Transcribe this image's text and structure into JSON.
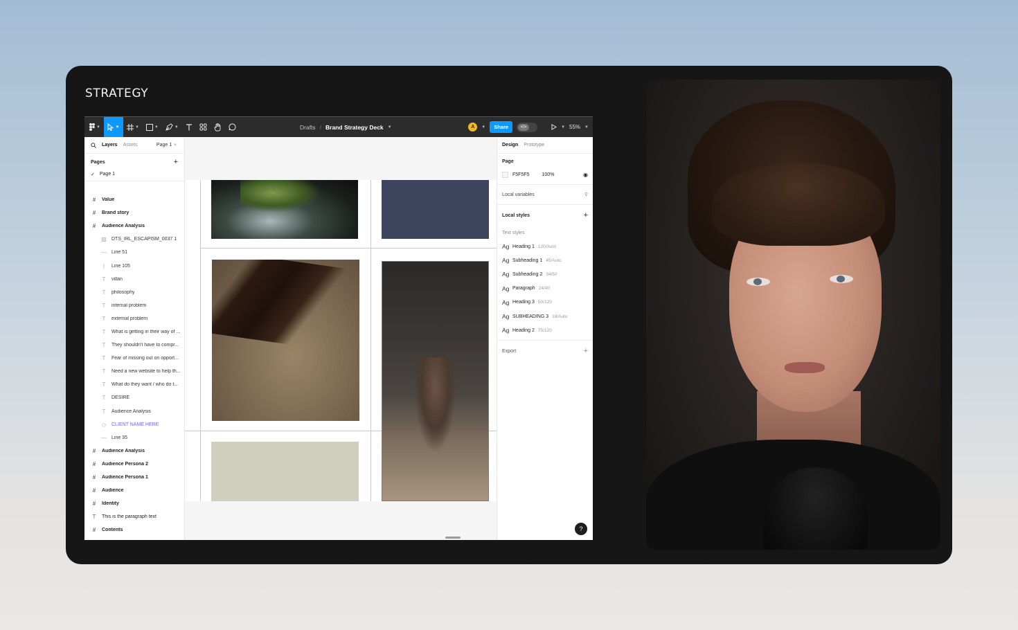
{
  "card_title": "STRATEGY",
  "toolbar": {
    "breadcrumb_drafts": "Drafts",
    "breadcrumb_sep": "/",
    "file_name": "Brand Strategy Deck",
    "avatar_initial": "A",
    "share_label": "Share",
    "zoom": "55%"
  },
  "left_panel": {
    "tab_layers": "Layers",
    "tab_assets": "Assets",
    "page_selector": "Page 1",
    "pages_heading": "Pages",
    "current_page": "Page 1",
    "layers": [
      {
        "type": "frame",
        "icon": "#",
        "name": "Value"
      },
      {
        "type": "frame",
        "icon": "#",
        "name": "Brand story"
      },
      {
        "type": "frame",
        "icon": "#",
        "name": "Audience Analysis"
      },
      {
        "type": "image",
        "icon": "▨",
        "name": "DTS_IRL_ESCAPISM_0037 1"
      },
      {
        "type": "line",
        "icon": "—",
        "name": "Line 51"
      },
      {
        "type": "line",
        "icon": "|",
        "name": "Line 105"
      },
      {
        "type": "text",
        "icon": "T",
        "name": "villan"
      },
      {
        "type": "text",
        "icon": "T",
        "name": "philosophy"
      },
      {
        "type": "text",
        "icon": "T",
        "name": "internal problem"
      },
      {
        "type": "text",
        "icon": "T",
        "name": "external problem"
      },
      {
        "type": "text",
        "icon": "T",
        "name": "What is getting in their way of ..."
      },
      {
        "type": "text",
        "icon": "T",
        "name": "They shouldn't have to compr..."
      },
      {
        "type": "text",
        "icon": "T",
        "name": "Fear of missing out on opport..."
      },
      {
        "type": "text",
        "icon": "T",
        "name": "Need a new website to help th..."
      },
      {
        "type": "text",
        "icon": "T",
        "name": "What do they want / who do t..."
      },
      {
        "type": "text",
        "icon": "T",
        "name": "DESIRE"
      },
      {
        "type": "text",
        "icon": "T",
        "name": "Audience Analysis"
      },
      {
        "type": "component",
        "icon": "◇",
        "name": "CLIENT NAME HERE"
      },
      {
        "type": "line",
        "icon": "—",
        "name": "Line 35"
      },
      {
        "type": "frame",
        "icon": "#",
        "name": "Audience Analysis"
      },
      {
        "type": "frame",
        "icon": "#",
        "name": "Audience Persona 2"
      },
      {
        "type": "frame",
        "icon": "#",
        "name": "Audience Persona 1"
      },
      {
        "type": "frame",
        "icon": "#",
        "name": "Audience"
      },
      {
        "type": "frame",
        "icon": "#",
        "name": "Identity"
      },
      {
        "type": "textroot",
        "icon": "T",
        "name": "This is the paragraph text"
      },
      {
        "type": "frame",
        "icon": "#",
        "name": "Contents"
      }
    ]
  },
  "right_panel": {
    "tab_design": "Design",
    "tab_prototype": "Prototype",
    "page_heading": "Page",
    "page_fill_hex": "F5F5F5",
    "page_fill_opacity": "100%",
    "local_variables": "Local variables",
    "local_styles": "Local styles",
    "text_styles_label": "Text styles",
    "text_styles": [
      {
        "ag": "Ag",
        "name": "Heading 1",
        "meta": "120/Auto"
      },
      {
        "ag": "Ag",
        "name": "Subheading 1",
        "meta": "45/Auto"
      },
      {
        "ag": "Ag",
        "name": "Subheading 2",
        "meta": "34/50"
      },
      {
        "ag": "Ag",
        "name": "Paragraph",
        "meta": "24/40"
      },
      {
        "ag": "Ag",
        "name": "Heading 3",
        "meta": "50/120"
      },
      {
        "ag": "Ag",
        "name": "SUBHEADING 3",
        "meta": "18/Auto"
      },
      {
        "ag": "Ag",
        "name": "Heading 2",
        "meta": "75/120"
      }
    ],
    "export_label": "Export",
    "help": "?"
  },
  "colors": {
    "accent": "#0d99ff",
    "toolbar_bg": "#2c2c2c",
    "canvas_bg": "#f5f5f5",
    "navy_block": "#3e445e",
    "sage_block": "#d0cfbd"
  }
}
